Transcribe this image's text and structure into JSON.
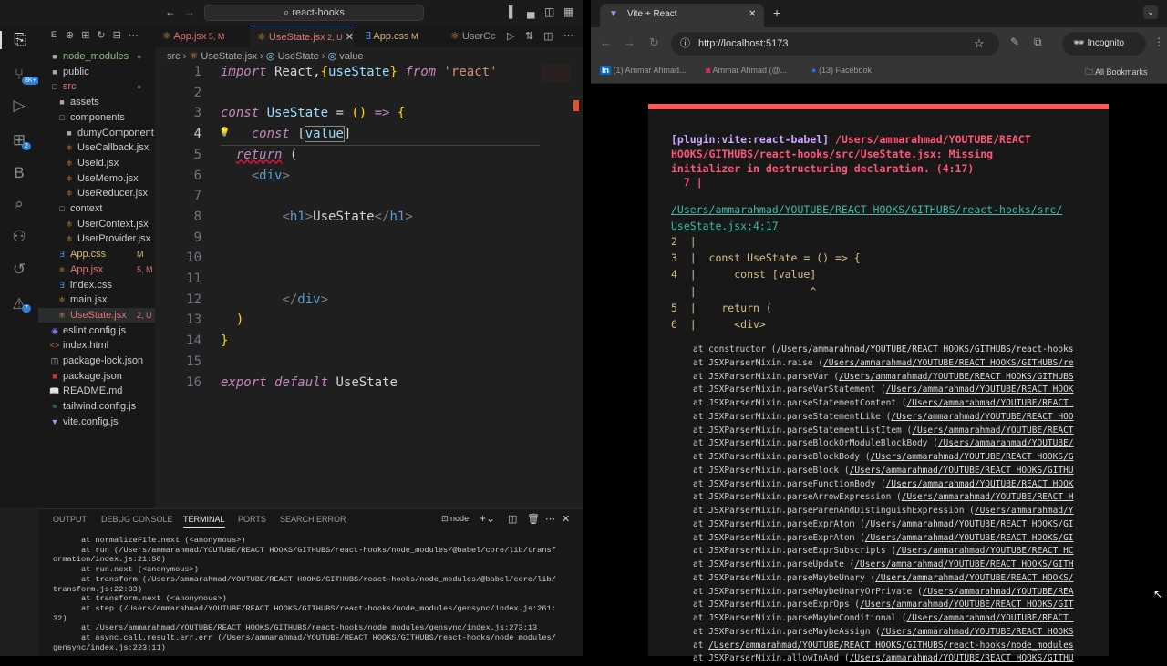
{
  "vscode": {
    "title_search": "react-hooks",
    "explorer_label": "E",
    "activity_badges": {
      "source_control": "8K+",
      "extensions": "2",
      "problems": "7"
    },
    "tree": [
      {
        "name": "node_modules",
        "indent": 0,
        "icon": "folder",
        "color": "#8fbf7f",
        "status": "●"
      },
      {
        "name": "public",
        "indent": 0,
        "icon": "folder",
        "color": "#ccc",
        "status": ""
      },
      {
        "name": "src",
        "indent": 0,
        "icon": "folder-open",
        "color": "#e07474",
        "status": "●"
      },
      {
        "name": "assets",
        "indent": 1,
        "icon": "folder",
        "color": "#ccc",
        "status": ""
      },
      {
        "name": "components",
        "indent": 1,
        "icon": "folder-open",
        "color": "#ccc",
        "status": ""
      },
      {
        "name": "dumyComponent",
        "indent": 2,
        "icon": "folder",
        "color": "#ccc",
        "status": ""
      },
      {
        "name": "UseCallback.jsx",
        "indent": 2,
        "icon": "react",
        "color": "#ccc",
        "status": ""
      },
      {
        "name": "UseId.jsx",
        "indent": 2,
        "icon": "react",
        "color": "#ccc",
        "status": ""
      },
      {
        "name": "UseMemo.jsx",
        "indent": 2,
        "icon": "react",
        "color": "#ccc",
        "status": ""
      },
      {
        "name": "UseReducer.jsx",
        "indent": 2,
        "icon": "react",
        "color": "#ccc",
        "status": ""
      },
      {
        "name": "context",
        "indent": 1,
        "icon": "folder-open",
        "color": "#ccc",
        "status": ""
      },
      {
        "name": "UserContext.jsx",
        "indent": 2,
        "icon": "react",
        "color": "#ccc",
        "status": ""
      },
      {
        "name": "UserProvider.jsx",
        "indent": 2,
        "icon": "react",
        "color": "#ccc",
        "status": ""
      },
      {
        "name": "App.css",
        "indent": 1,
        "icon": "css",
        "color": "#d7ba7d",
        "status": "M"
      },
      {
        "name": "App.jsx",
        "indent": 1,
        "icon": "react",
        "color": "#e07474",
        "status": "5, M"
      },
      {
        "name": "index.css",
        "indent": 1,
        "icon": "css",
        "color": "#ccc",
        "status": ""
      },
      {
        "name": "main.jsx",
        "indent": 1,
        "icon": "react",
        "color": "#ccc",
        "status": ""
      },
      {
        "name": "UseState.jsx",
        "indent": 1,
        "icon": "react",
        "color": "#e07474",
        "status": "2, U"
      },
      {
        "name": "eslint.config.js",
        "indent": 0,
        "icon": "eslint",
        "color": "#ccc",
        "status": ""
      },
      {
        "name": "index.html",
        "indent": 0,
        "icon": "html",
        "color": "#ccc",
        "status": ""
      },
      {
        "name": "package-lock.json",
        "indent": 0,
        "icon": "json",
        "color": "#ccc",
        "status": ""
      },
      {
        "name": "package.json",
        "indent": 0,
        "icon": "npm",
        "color": "#ccc",
        "status": ""
      },
      {
        "name": "README.md",
        "indent": 0,
        "icon": "book",
        "color": "#ccc",
        "status": ""
      },
      {
        "name": "tailwind.config.js",
        "indent": 0,
        "icon": "tailwind",
        "color": "#ccc",
        "status": ""
      },
      {
        "name": "vite.config.js",
        "indent": 0,
        "icon": "vite",
        "color": "#ccc",
        "status": ""
      }
    ],
    "tabs": [
      {
        "label": "App.jsx",
        "status": "5, M",
        "color": "#e07474",
        "icon": "react"
      },
      {
        "label": "UseState.jsx",
        "status": "2, U",
        "color": "#e07474",
        "icon": "react",
        "active": true
      },
      {
        "label": "App.css",
        "status": "M",
        "color": "#d7ba7d",
        "icon": "css"
      },
      {
        "label": "UserCc",
        "status": "",
        "color": "#999",
        "icon": "react"
      }
    ],
    "breadcrumb": [
      "src",
      "UseState.jsx",
      "UseState",
      "value"
    ],
    "code": [
      [
        [
          "import",
          "kw"
        ],
        [
          " React,",
          "pl"
        ],
        [
          "{",
          "br"
        ],
        [
          "useState",
          "var"
        ],
        [
          "}",
          "br"
        ],
        [
          " ",
          "pl"
        ],
        [
          "from",
          "kw"
        ],
        [
          " 'react'",
          "str"
        ]
      ],
      [],
      [
        [
          "const",
          "kw"
        ],
        [
          " UseState",
          "var"
        ],
        [
          " = ",
          "pl"
        ],
        [
          "()",
          "br"
        ],
        [
          " => ",
          "kw"
        ],
        [
          "{",
          "br"
        ]
      ],
      [
        [
          "    ",
          "pl"
        ],
        [
          "const",
          "kw"
        ],
        [
          " [",
          "pl"
        ],
        [
          "value",
          "var"
        ],
        [
          "]",
          "pl"
        ]
      ],
      [
        [
          "  ",
          "pl"
        ],
        [
          "return",
          "ret"
        ],
        [
          " (",
          "pl"
        ]
      ],
      [
        [
          "    ",
          "pl"
        ],
        [
          "<",
          "tagc"
        ],
        [
          "div",
          "tag"
        ],
        [
          ">",
          "tagc"
        ]
      ],
      [],
      [
        [
          "        ",
          "pl"
        ],
        [
          "<",
          "tagc"
        ],
        [
          "h1",
          "tag"
        ],
        [
          ">",
          "tagc"
        ],
        [
          "UseState",
          "pl"
        ],
        [
          "</",
          "tagc"
        ],
        [
          "h1",
          "tag"
        ],
        [
          ">",
          "tagc"
        ]
      ],
      [],
      [],
      [],
      [
        [
          "        ",
          "pl"
        ],
        [
          "</",
          "tagc"
        ],
        [
          "div",
          "tag"
        ],
        [
          ">",
          "tagc"
        ]
      ],
      [
        [
          "  ",
          "pl"
        ],
        [
          ")",
          "br"
        ]
      ],
      [
        [
          "}",
          "br"
        ]
      ],
      [],
      [
        [
          "export",
          "kw"
        ],
        [
          " ",
          "pl"
        ],
        [
          "default",
          "kw"
        ],
        [
          " UseState",
          "pl"
        ]
      ]
    ],
    "panel_tabs": [
      "OUTPUT",
      "DEBUG CONSOLE",
      "TERMINAL",
      "PORTS",
      "SEARCH ERROR"
    ],
    "terminal_name": "node",
    "terminal": [
      "      at normalizeFile.next (<anonymous>)",
      "      at run (/Users/ammarahmad/YOUTUBE/REACT HOOKS/GITHUBS/react-hooks/node_modules/@babel/core/lib/transf",
      "ormation/index.js:21:50)",
      "      at run.next (<anonymous>)",
      "      at transform (/Users/ammarahmad/YOUTUBE/REACT HOOKS/GITHUBS/react-hooks/node_modules/@babel/core/lib/",
      "transform.js:22:33)",
      "      at transform.next (<anonymous>)",
      "      at step (/Users/ammarahmad/YOUTUBE/REACT HOOKS/GITHUBS/react-hooks/node_modules/gensync/index.js:261:",
      "32)",
      "      at /Users/ammarahmad/YOUTUBE/REACT HOOKS/GITHUBS/react-hooks/node_modules/gensync/index.js:273:13",
      "      at async.call.result.err.err (/Users/ammarahmad/YOUTUBE/REACT HOOKS/GITHUBS/react-hooks/node_modules/",
      "gensync/index.js:223:11)"
    ]
  },
  "browser": {
    "tab_title": "Vite + React",
    "url": "http://localhost:5173",
    "incognito": "Incognito",
    "bookmarks": [
      "(1) Ammar Ahmad...",
      "Ammar Ahmad (@...",
      "(13) Facebook"
    ],
    "all_bookmarks": "All Bookmarks",
    "error": {
      "plugin": "[plugin:vite:react-babel]",
      "message_lines": [
        " /Users/ammarahmad/YOUTUBE/REACT",
        "HOOKS/GITHUBS/react-hooks/src/UseState.jsx: Missing",
        "initializer in destructuring declaration. (4:17)",
        "  7 |"
      ],
      "file_link_lines": [
        "/Users/ammarahmad/YOUTUBE/REACT HOOKS/GITHUBS/react-hooks/src/",
        "UseState.jsx:4:17"
      ],
      "frame": [
        "2  |",
        "3  |  const UseState = () => {",
        "4  |      const [value]",
        "   |                  ^",
        "5  |    return (",
        "6  |      <div>"
      ],
      "stack": [
        [
          "at constructor (",
          "/Users/ammarahmad/YOUTUBE/REACT HOOKS/GITHUBS/react-hooks"
        ],
        [
          "at JSXParserMixin.raise (",
          "/Users/ammarahmad/YOUTUBE/REACT HOOKS/GITHUBS/re"
        ],
        [
          "at JSXParserMixin.parseVar (",
          "/Users/ammarahmad/YOUTUBE/REACT HOOKS/GITHUBS"
        ],
        [
          "at JSXParserMixin.parseVarStatement (",
          "/Users/ammarahmad/YOUTUBE/REACT HOOK"
        ],
        [
          "at JSXParserMixin.parseStatementContent (",
          "/Users/ammarahmad/YOUTUBE/REACT "
        ],
        [
          "at JSXParserMixin.parseStatementLike (",
          "/Users/ammarahmad/YOUTUBE/REACT HOO"
        ],
        [
          "at JSXParserMixin.parseStatementListItem (",
          "/Users/ammarahmad/YOUTUBE/REACT"
        ],
        [
          "at JSXParserMixin.parseBlockOrModuleBlockBody (",
          "/Users/ammarahmad/YOUTUBE/"
        ],
        [
          "at JSXParserMixin.parseBlockBody (",
          "/Users/ammarahmad/YOUTUBE/REACT HOOKS/G"
        ],
        [
          "at JSXParserMixin.parseBlock (",
          "/Users/ammarahmad/YOUTUBE/REACT HOOKS/GITHU"
        ],
        [
          "at JSXParserMixin.parseFunctionBody (",
          "/Users/ammarahmad/YOUTUBE/REACT HOOK"
        ],
        [
          "at JSXParserMixin.parseArrowExpression (",
          "/Users/ammarahmad/YOUTUBE/REACT H"
        ],
        [
          "at JSXParserMixin.parseParenAndDistinguishExpression (",
          "/Users/ammarahmad/Y"
        ],
        [
          "at JSXParserMixin.parseExprAtom (",
          "/Users/ammarahmad/YOUTUBE/REACT HOOKS/GI"
        ],
        [
          "at JSXParserMixin.parseExprAtom (",
          "/Users/ammarahmad/YOUTUBE/REACT HOOKS/GI"
        ],
        [
          "at JSXParserMixin.parseExprSubscripts (",
          "/Users/ammarahmad/YOUTUBE/REACT HC"
        ],
        [
          "at JSXParserMixin.parseUpdate (",
          "/Users/ammarahmad/YOUTUBE/REACT HOOKS/GITH"
        ],
        [
          "at JSXParserMixin.parseMaybeUnary (",
          "/Users/ammarahmad/YOUTUBE/REACT HOOKS/"
        ],
        [
          "at JSXParserMixin.parseMaybeUnaryOrPrivate (",
          "/Users/ammarahmad/YOUTUBE/REA"
        ],
        [
          "at JSXParserMixin.parseExprOps (",
          "/Users/ammarahmad/YOUTUBE/REACT HOOKS/GIT"
        ],
        [
          "at JSXParserMixin.parseMaybeConditional (",
          "/Users/ammarahmad/YOUTUBE/REACT "
        ],
        [
          "at JSXParserMixin.parseMaybeAssign (",
          "/Users/ammarahmad/YOUTUBE/REACT HOOKS"
        ],
        [
          "at ",
          "/Users/ammarahmad/YOUTUBE/REACT HOOKS/GITHUBS/react-hooks/node_modules"
        ],
        [
          "at JSXParserMixin.allowInAnd (",
          "/Users/ammarahmad/YOUTUBE/REACT HOOKS/GITHU"
        ]
      ]
    }
  }
}
